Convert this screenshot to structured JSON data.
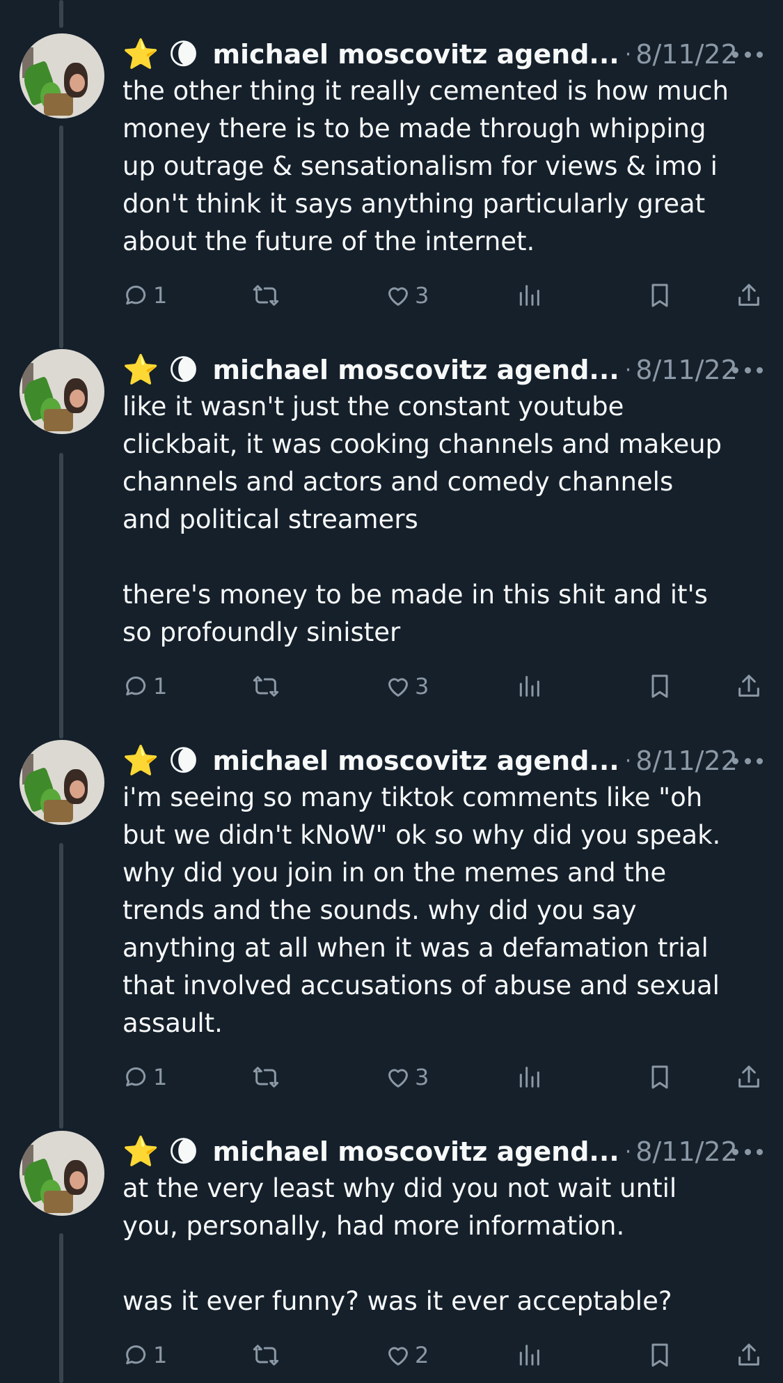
{
  "theme": {
    "background": "#15202b",
    "text": "#f7f9f9",
    "muted": "#8b98a5",
    "thread_line": "#38444d"
  },
  "tweets": [
    {
      "emoji": "⭐ 🌘",
      "name": "michael moscovitz agend...",
      "separator": "·",
      "date": "8/11/22",
      "text": "the other thing it really cemented is how much\nmoney there is to be made through whipping\nup outrage & sensationalism for views & imo i\ndon't think it says anything particularly great\nabout the future of the internet.",
      "replies": "1",
      "likes": "3"
    },
    {
      "emoji": "⭐ 🌘",
      "name": "michael moscovitz agend...",
      "separator": "·",
      "date": "8/11/22",
      "text": "like it wasn't just the constant youtube\nclickbait, it was cooking channels and makeup\nchannels and actors and comedy channels\nand political streamers\n\nthere's money to be made in this shit and it's\nso profoundly sinister",
      "replies": "1",
      "likes": "3"
    },
    {
      "emoji": "⭐ 🌘",
      "name": "michael moscovitz agend...",
      "separator": "·",
      "date": "8/11/22",
      "text": "i'm seeing so many tiktok comments like \"oh\nbut we didn't kNoW\" ok so why did you speak.\nwhy did you join in on the memes and the\ntrends and the sounds. why did you say\nanything at all when it was a defamation trial\nthat involved accusations of abuse and sexual\nassault.",
      "replies": "1",
      "likes": "3"
    },
    {
      "emoji": "⭐ 🌘",
      "name": "michael moscovitz agend...",
      "separator": "·",
      "date": "8/11/22",
      "text": "at the very least why did you not wait until\nyou, personally, had more information.\n\nwas it ever funny? was it ever acceptable?",
      "replies": "1",
      "likes": "2"
    }
  ]
}
